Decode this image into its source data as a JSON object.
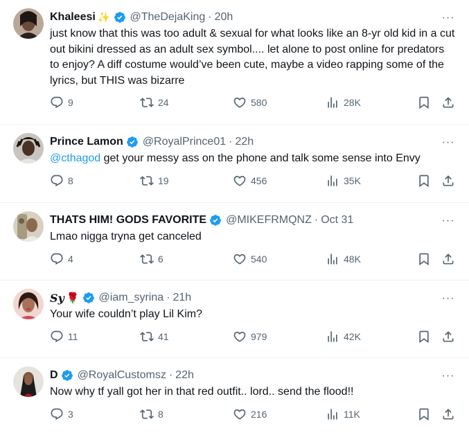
{
  "tweets": [
    {
      "name": "Khaleesi",
      "emoji": "✨",
      "handle": "@TheDejaKing",
      "time": "20h",
      "text": "just know that this was too adult & sexual for what looks like an 8-yr old kid in a cut out bikini dressed as an adult sex symbol.... let alone to post online for predators to enjoy? A diff costume would’ve been cute, maybe a video rapping some of the lyrics, but THIS was bizarre",
      "replies": "9",
      "reposts": "24",
      "likes": "580",
      "views": "28K"
    },
    {
      "name": "Prince Lamon",
      "handle": "@RoyalPrince01",
      "time": "22h",
      "mention": "@cthagod",
      "text": " get your messy ass on the phone and talk some sense into Envy",
      "replies": "8",
      "reposts": "19",
      "likes": "456",
      "views": "35K"
    },
    {
      "name": "THATS HIM! GODS FAVORITE",
      "handle": "@MIKEFRMQNZ",
      "time": "Oct 31",
      "text": "Lmao nigga tryna get canceled",
      "replies": "4",
      "reposts": "6",
      "likes": "540",
      "views": "48K"
    },
    {
      "name": "Sy",
      "emoji": "🌹",
      "handle": "@iam_syrina",
      "time": "21h",
      "text": "Your wife couldn’t play Lil Kim?",
      "replies": "11",
      "reposts": "41",
      "likes": "979",
      "views": "42K"
    },
    {
      "name": "D",
      "handle": "@RoyalCustomsz",
      "time": "22h",
      "text": "Now why tf yall got her in that red outfit.. lord.. send the flood!!",
      "replies": "3",
      "reposts": "8",
      "likes": "216",
      "views": "11K"
    }
  ],
  "separator": "·",
  "more_glyph": "···",
  "colors": {
    "accent": "#1d9bf0",
    "muted": "#536471",
    "text": "#0f1419",
    "divider": "#eff3f4"
  },
  "icons": [
    "verified-badge-icon",
    "more-icon",
    "reply-icon",
    "repost-icon",
    "like-icon",
    "views-icon",
    "bookmark-icon",
    "share-icon"
  ]
}
